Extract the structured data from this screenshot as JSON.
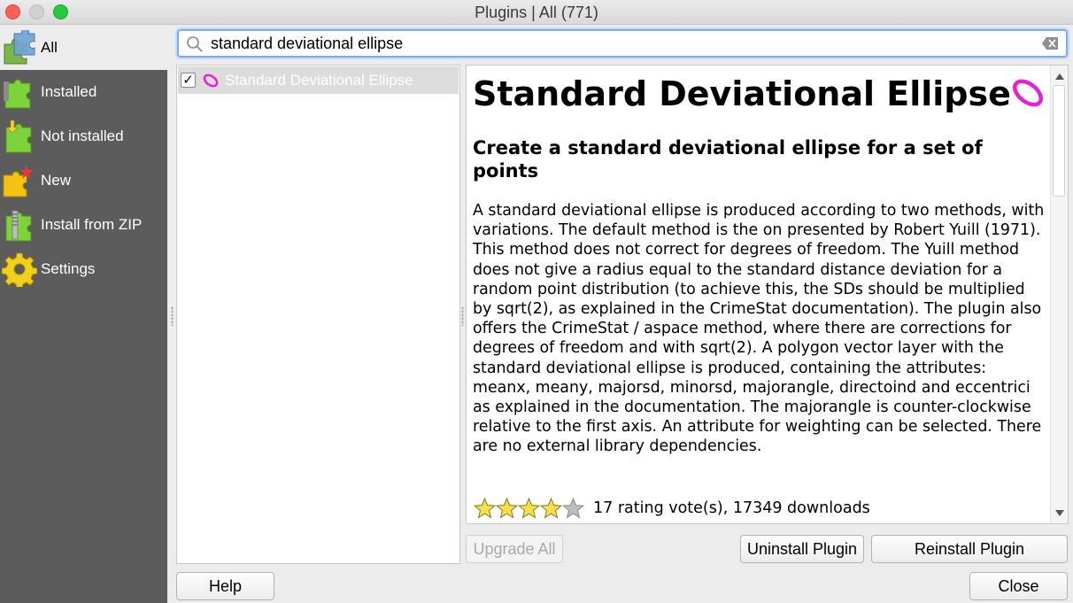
{
  "window": {
    "title": "Plugins | All (771)"
  },
  "sidebar": {
    "items": [
      {
        "label": "All",
        "icon": "puzzle-all-icon",
        "selected": true
      },
      {
        "label": "Installed",
        "icon": "puzzle-installed-icon"
      },
      {
        "label": "Not installed",
        "icon": "puzzle-download-icon"
      },
      {
        "label": "New",
        "icon": "puzzle-new-icon"
      },
      {
        "label": "Install from ZIP",
        "icon": "puzzle-zip-icon"
      },
      {
        "label": "Settings",
        "icon": "gear-icon"
      }
    ]
  },
  "search": {
    "value": "standard deviational ellipse",
    "placeholder": ""
  },
  "plugin_list": {
    "items": [
      {
        "label": "Standard Deviational Ellipse",
        "checked": true,
        "check_glyph": "✓"
      }
    ]
  },
  "details": {
    "title": "Standard Deviational Ellipse",
    "subtitle": "Create a standard deviational ellipse for a set of points",
    "description": "A standard deviational ellipse is produced according to two methods, with variations. The default method is the on presented by Robert Yuill (1971). This method does not correct for degrees of freedom. The Yuill method does not give a radius equal to the standard distance deviation for a random point distribution (to achieve this, the SDs should be multiplied by sqrt(2), as explained in the CrimeStat documentation). The plugin also offers the CrimeStat / aspace method, where there are corrections for degrees of freedom and with sqrt(2). A polygon vector layer with the standard deviational ellipse is produced, containing the attributes: meanx, meany, majorsd, minorsd, majorangle, directoind and eccentrici as explained in the documentation. The majorangle is counter-clockwise relative to the first axis. An attribute for weighting can be selected. There are no external library dependencies.",
    "rating": {
      "stars_filled": 4,
      "stars_total": 5,
      "text": "17 rating vote(s), 17349 downloads"
    }
  },
  "buttons": {
    "upgrade_all": "Upgrade All",
    "uninstall": "Uninstall Plugin",
    "reinstall": "Reinstall Plugin",
    "help": "Help",
    "close": "Close"
  },
  "colors": {
    "accent": "#7faef0",
    "sidebar_bg": "#5c5c5c",
    "ellipse": "#e81fd9",
    "star": "#f4e04d"
  }
}
